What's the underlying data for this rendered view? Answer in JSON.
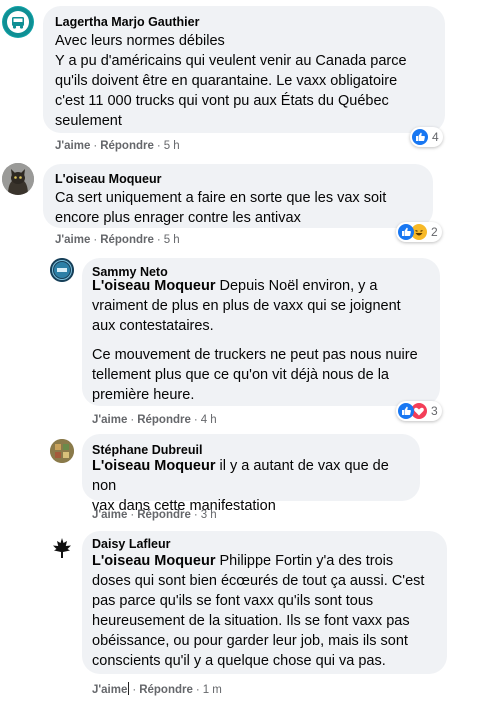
{
  "comments": [
    {
      "author": "Lagertha Marjo Gauthier",
      "lines": [
        "Avec leurs normes débiles",
        "Y a pu d'américains qui veulent venir au Canada parce",
        "qu'ils doivent être en quarantaine. Le vaxx obligatoire",
        "c'est 11 000 trucks qui vont pu aux États du Québec",
        "seulement"
      ],
      "like": "J'aime",
      "reply": "Répondre",
      "time": "5 h",
      "reaction_count": "4"
    },
    {
      "author": "L'oiseau Moqueur",
      "lines": [
        "Ca sert uniquement a faire en sorte que les vax soit",
        "encore plus enrager contre les antivax"
      ],
      "like": "J'aime",
      "reply": "Répondre",
      "time": "5 h",
      "reaction_count": "2"
    },
    {
      "author": "Sammy Neto",
      "mention": "L'oiseau Moqueur",
      "lines": [
        "Depuis Noël environ, y a",
        "vraiment de plus en plus de vaxx qui se joignent",
        "aux contestataires."
      ],
      "lines2": [
        "Ce mouvement de truckers ne peut pas nous nuire",
        "tellement plus que ce qu'on vit déjà nous de la",
        "première heure."
      ],
      "like": "J'aime",
      "reply": "Répondre",
      "time": "4 h",
      "reaction_count": "3"
    },
    {
      "author": "Stéphane Dubreuil",
      "mention": "L'oiseau Moqueur",
      "lines": [
        "il y a autant de vax que de non",
        "vax dans cette manifestation"
      ],
      "like": "J'aime",
      "reply": "Répondre",
      "time": "3 h"
    },
    {
      "author": "Daisy Lafleur",
      "mention": "L'oiseau Moqueur",
      "lines": [
        "Philippe Fortin y'a des trois",
        "doses qui sont bien écœurés de tout ça aussi. C'est",
        "pas parce qu'ils se font vaxx qu'ils sont tous",
        "heureusement de la situation. Ils se font vaxx pas",
        "obéissance, ou pour garder leur job, mais ils sont",
        "conscients qu'il y a quelque chose qui va pas."
      ],
      "like": "J'aime",
      "reply": "Répondre",
      "time": "1 m"
    }
  ],
  "colors": {
    "bubble": "#f0f2f5",
    "meta_text": "#65676b",
    "like_blue": "#1877f2",
    "love_red": "#f33e58",
    "haha_yellow": "#f7b928"
  },
  "icons": [
    "truck-avatar-icon",
    "cat-avatar-icon",
    "badge-avatar-icon",
    "grid-avatar-icon",
    "leaf-avatar-icon",
    "like-reaction-icon",
    "haha-reaction-icon",
    "love-reaction-icon"
  ]
}
